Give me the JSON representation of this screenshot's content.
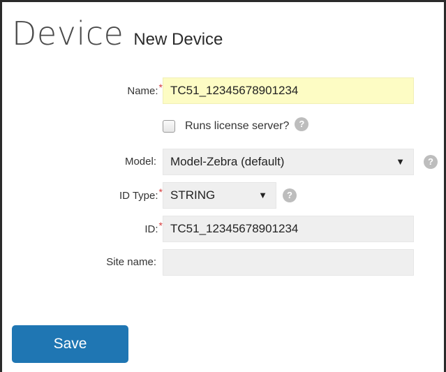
{
  "header": {
    "title": "Device",
    "subtitle": "New Device"
  },
  "form": {
    "name": {
      "label": "Name:",
      "required": "*",
      "value": "TC51_12345678901234"
    },
    "runs_license_server": {
      "label": "Runs license server?",
      "checked": false,
      "help_icon": "question-circle-icon"
    },
    "model": {
      "label": "Model:",
      "value": "Model-Zebra (default)",
      "caret": "▼",
      "help_icon": "question-circle-icon"
    },
    "id_type": {
      "label": "ID Type:",
      "required": "*",
      "value": "STRING",
      "caret": "▼",
      "help_icon": "question-circle-icon"
    },
    "id": {
      "label": "ID:",
      "required": "*",
      "value": "TC51_12345678901234"
    },
    "site_name": {
      "label": "Site name:",
      "value": ""
    }
  },
  "actions": {
    "save_label": "Save"
  },
  "colors": {
    "accent": "#1f76b3",
    "required": "#d43b3b",
    "highlight": "#fdfcc4",
    "field_bg": "#efefef"
  }
}
